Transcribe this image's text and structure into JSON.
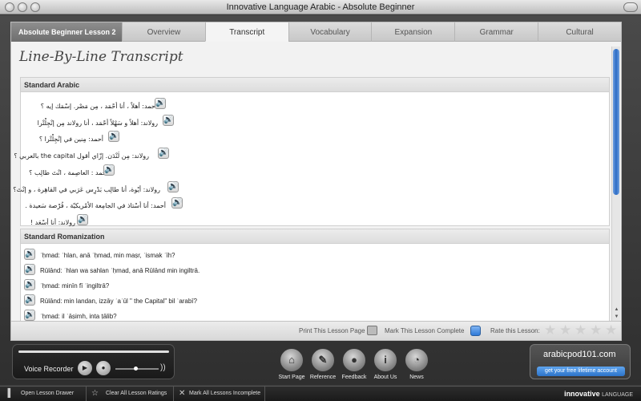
{
  "window": {
    "title": "Innovative Language Arabic - Absolute Beginner"
  },
  "tabs": {
    "lesson": "Absolute Beginner Lesson 2",
    "items": [
      "Overview",
      "Transcript",
      "Vocabulary",
      "Expansion",
      "Grammar",
      "Cultural"
    ],
    "active": "Transcript"
  },
  "page": {
    "title": "Line-By-Line Transcript"
  },
  "standard_arabic": {
    "header": "Standard Arabic",
    "lines": [
      "أحمد: أهلاً ، أنا أحْمَد ، مِن مَصْر. إسْمَك إيه ؟",
      "رولاند: أهلاً و سَهْلاً أحْمَد ، أنا رولاند مِن إنْجِلْتْرا",
      "أحمد: مِنين في إنْجِلْتْرا ؟",
      "رولاند: مِن لَنْدَن. إزّاي أقول the capital بالعربي ؟",
      "أحمد : العاصِمة ، انْتَ طالِب ؟",
      "رولاند: أيْوة، أنا طالِب بَدْرِس عَرَبي في القاهِرة ، و إنْتَ؟",
      "أحمد: أنا أسْتاذ في الجامِعة الأمْريكيّة ، فُرْصة سَعيدة .",
      "رولاند: أنا أسْعَد !"
    ]
  },
  "standard_romanization": {
    "header": "Standard Romanization",
    "lines": [
      "ʾḥmad: ʾhlan, anā ʾḥmad, min maṣr, ʾismak ʾīh?",
      "Rūlānd: ʾhlan wa sahlan ʾḥmad, anā Rūlānd min ingiltrā.",
      "ʾḥmad: minīn fī ʾingiltrā?",
      "Rūlānd: min landan, izzāy ʾaʿūl \" the Capital\" bil ʿarabī?",
      "ʾḥmad: il ʿāṣimh, inta ṭālib?"
    ]
  },
  "footer": {
    "print": "Print This Lesson Page",
    "complete": "Mark This Lesson Complete",
    "rate": "Rate this Lesson:",
    "rating": 0,
    "max_rating": 5
  },
  "recorder": {
    "label": "Voice Recorder",
    "volume_level": 0.45
  },
  "nav": {
    "start": "Start Page",
    "reference": "Reference",
    "feedback": "Feedback",
    "about": "About Us",
    "news": "News"
  },
  "promo": {
    "brand": "arabicpod101.com",
    "button": "get your free lifetime account"
  },
  "bottombar": {
    "open_drawer": "Open Lesson Drawer",
    "clear_ratings": "Clear All Lesson Ratings",
    "mark_incomplete": "Mark All Lessons Incomplete",
    "logo_main": "innovative",
    "logo_sub": "LANGUAGE"
  },
  "icons": {
    "speaker": "speaker-icon",
    "play": "play-icon",
    "stop": "stop-icon",
    "star": "star-icon",
    "home": "home-icon",
    "reference": "book-icon",
    "feedback": "chat-bubble-icon",
    "about": "info-icon",
    "news": "rss-icon"
  }
}
